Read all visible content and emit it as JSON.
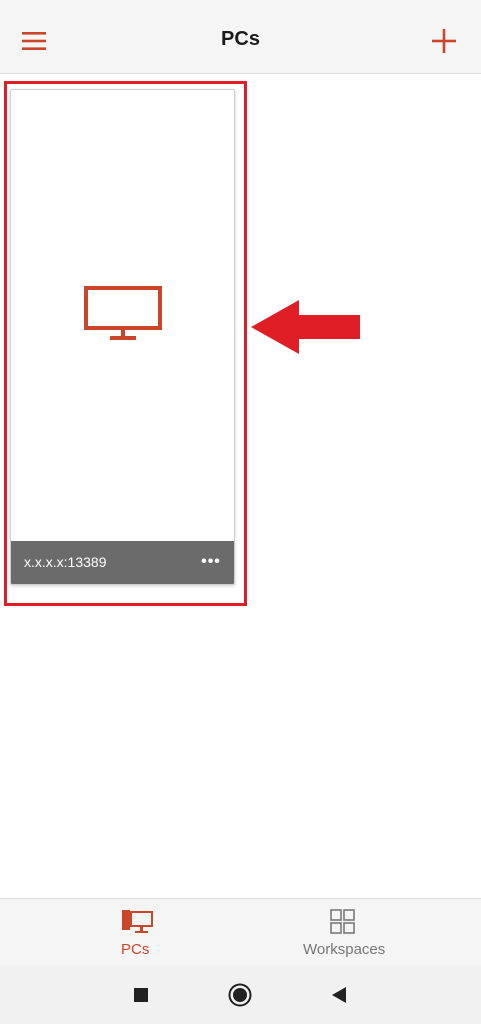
{
  "header": {
    "title": "PCs",
    "menu_icon": "hamburger-menu-icon",
    "add_icon": "plus-icon"
  },
  "pc_tile": {
    "name": "x.x.x.x:13389",
    "thumbnail_icon": "monitor-icon",
    "more_label": "•••"
  },
  "tabs": [
    {
      "label": "PCs",
      "icon": "pc-monitor-icon",
      "selected": true
    },
    {
      "label": "Workspaces",
      "icon": "workspaces-grid-icon",
      "selected": false
    }
  ],
  "system_nav": {
    "recents_icon": "recents-square-icon",
    "home_icon": "home-circle-icon",
    "back_icon": "back-triangle-icon"
  },
  "colors": {
    "accent": "#c9462a",
    "highlight": "#e01e26",
    "tile_footer": "#6b6b6b",
    "inactive_tab": "#767676"
  }
}
